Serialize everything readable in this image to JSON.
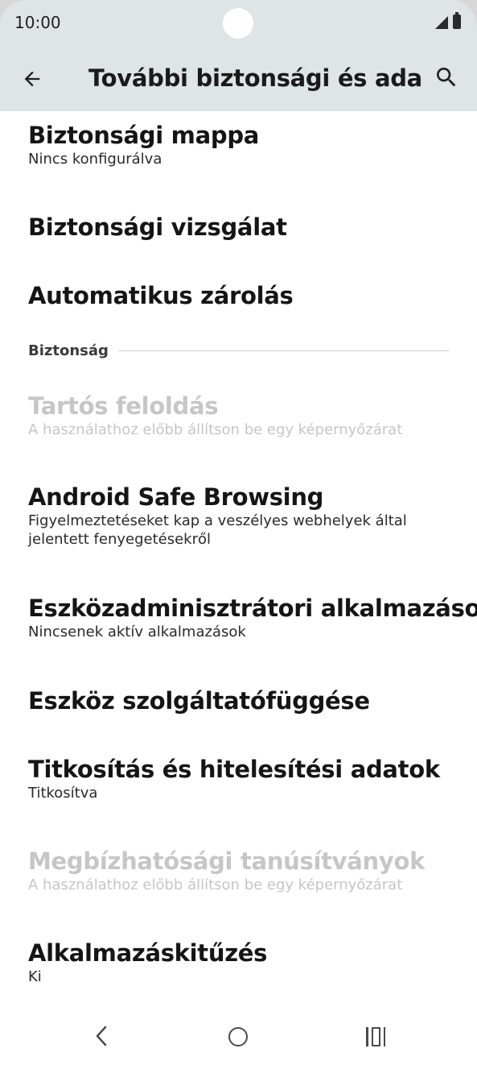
{
  "status_bar": {
    "time": "10:00",
    "icons": [
      "camera-cutout",
      "signal-icon",
      "battery-icon"
    ]
  },
  "app_bar": {
    "back_icon": "arrow-left-icon",
    "title": "További biztonsági és adatv...",
    "search_icon": "search-icon"
  },
  "items": [
    {
      "title": "Biztonsági mappa",
      "subtitle": "Nincs konfigurálva",
      "enabled": true
    },
    {
      "title": "Biztonsági vizsgálat",
      "subtitle": "",
      "enabled": true
    },
    {
      "title": "Automatikus zárolás",
      "subtitle": "",
      "enabled": true
    }
  ],
  "section": {
    "label": "Biztonság"
  },
  "section_items": [
    {
      "title": "Tartós feloldás",
      "subtitle": "A használathoz előbb állítson be egy képernyőzárat",
      "enabled": false
    },
    {
      "title": "Android Safe Browsing",
      "subtitle": "Figyelmeztetéseket kap a veszélyes webhelyek által jelentett fenyegetésekről",
      "enabled": true
    },
    {
      "title": "Eszközadminisztrátori alkalmazások",
      "subtitle": "Nincsenek aktív alkalmazások",
      "enabled": true
    },
    {
      "title": "Eszköz szolgáltatófüggése",
      "subtitle": "",
      "enabled": true
    },
    {
      "title": "Titkosítás és hitelesítési adatok",
      "subtitle": "Titkosítva",
      "enabled": true
    },
    {
      "title": "Megbízhatósági tanúsítványok",
      "subtitle": "A használathoz előbb állítson be egy képernyőzárat",
      "enabled": false
    },
    {
      "title": "Alkalmazáskitűzés",
      "subtitle": "Ki",
      "enabled": true
    }
  ],
  "nav_bar": {
    "back": "<",
    "icons": [
      "nav-back-icon",
      "nav-home-icon",
      "nav-recents-icon"
    ]
  },
  "colors": {
    "topbar_bg": "#dfe4e4",
    "text_primary": "#151515",
    "text_disabled": "#c6c6c6",
    "divider": "#cfcfcf"
  }
}
